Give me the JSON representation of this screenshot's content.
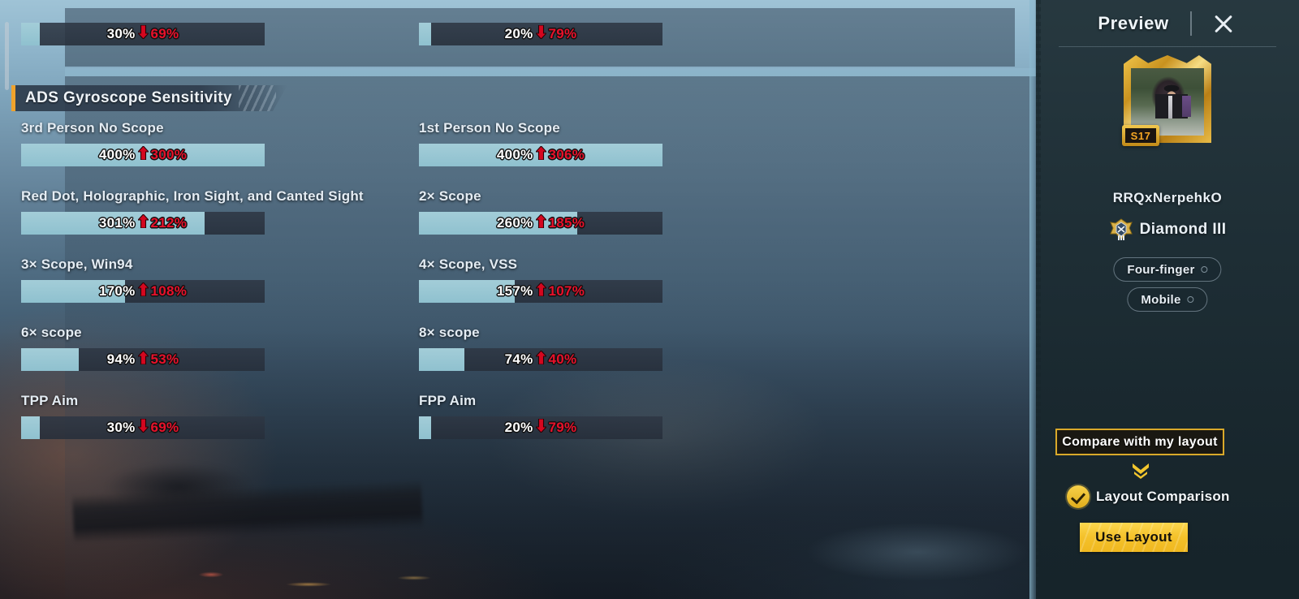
{
  "panel": {
    "section_title": "ADS Gyroscope Sensitivity",
    "scale_max": 400
  },
  "top_partial_row": [
    {
      "label": "",
      "value_label": "30%",
      "delta_label": "69%",
      "direction": "down",
      "value": 30
    },
    {
      "label": "",
      "value_label": "20%",
      "delta_label": "79%",
      "direction": "down",
      "value": 20
    }
  ],
  "sliders": [
    [
      {
        "label": "3rd Person No Scope",
        "value_label": "400%",
        "delta_label": "300%",
        "direction": "up",
        "value": 400
      },
      {
        "label": "1st Person No Scope",
        "value_label": "400%",
        "delta_label": "306%",
        "direction": "up",
        "value": 400
      }
    ],
    [
      {
        "label": "Red Dot, Holographic, Iron Sight, and Canted Sight",
        "value_label": "301%",
        "delta_label": "212%",
        "direction": "up",
        "value": 301
      },
      {
        "label": "2× Scope",
        "value_label": "260%",
        "delta_label": "185%",
        "direction": "up",
        "value": 260
      }
    ],
    [
      {
        "label": "3× Scope, Win94",
        "value_label": "170%",
        "delta_label": "108%",
        "direction": "up",
        "value": 170
      },
      {
        "label": "4× Scope, VSS",
        "value_label": "157%",
        "delta_label": "107%",
        "direction": "up",
        "value": 157
      }
    ],
    [
      {
        "label": "6× scope",
        "value_label": "94%",
        "delta_label": "53%",
        "direction": "up",
        "value": 94
      },
      {
        "label": "8× scope",
        "value_label": "74%",
        "delta_label": "40%",
        "direction": "up",
        "value": 74
      }
    ],
    [
      {
        "label": "TPP Aim",
        "value_label": "30%",
        "delta_label": "69%",
        "direction": "down",
        "value": 30
      },
      {
        "label": "FPP Aim",
        "value_label": "20%",
        "delta_label": "79%",
        "direction": "down",
        "value": 20
      }
    ]
  ],
  "sidebar": {
    "title": "Preview",
    "close_icon": "close-icon",
    "avatar": {
      "season_badge": "S17"
    },
    "username": "RRQxNerpehkO",
    "rank": "Diamond III",
    "tags": [
      {
        "label": "Four-finger"
      },
      {
        "label": "Mobile"
      }
    ],
    "compare_button": "Compare with my layout",
    "layout_comparison_label": "Layout Comparison",
    "use_layout_button": "Use Layout"
  },
  "colors": {
    "accent_orange": "#f0a32c",
    "slider_fill": "#8fc1cf",
    "slider_track": "#2e3744",
    "delta_red": "#e8112b",
    "gold": "#f4c12a",
    "text_primary": "#e9f0f6"
  }
}
